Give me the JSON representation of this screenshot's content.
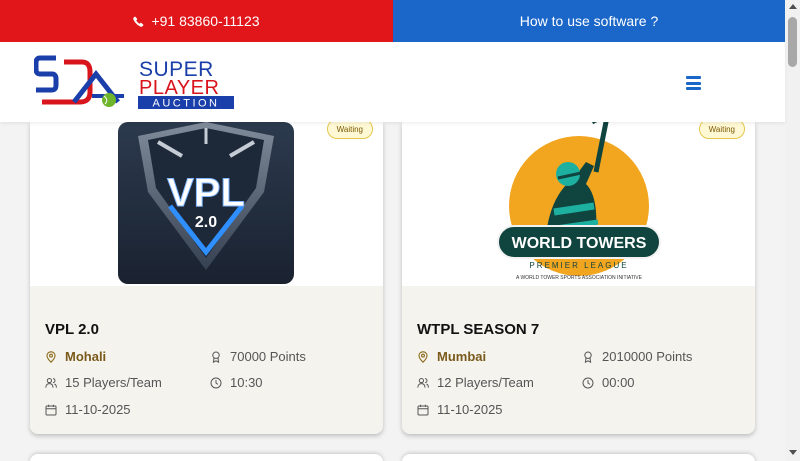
{
  "topbar": {
    "phone": "+91 83860-11123",
    "howto": "How to use software ?"
  },
  "brand": {
    "line1": "SUPER",
    "line2": "PLAYER",
    "line3": "AUCTION",
    "colors": {
      "blue": "#1a3faa",
      "red": "#d8141c",
      "green": "#6fb52c"
    }
  },
  "menu_icon": "hamburger-icon",
  "tournaments": [
    {
      "status": "Waiting",
      "logo_text": "VPL",
      "logo_sub": "2.0",
      "name": "VPL 2.0",
      "location": "Mohali",
      "points": "70000 Points",
      "players": "15 Players/Team",
      "time": "10:30",
      "date": "11-10-2025"
    },
    {
      "status": "Waiting",
      "logo_text": "WORLD TOWERS",
      "logo_sub": "PREMIER LEAGUE",
      "logo_tagline": "A WORLD TOWER SPORTS ASSOCIATION INITIATIVE",
      "name": "WTPL SEASON 7",
      "location": "Mumbai",
      "points": "2010000 Points",
      "players": "12 Players/Team",
      "time": "00:00",
      "date": "11-10-2025"
    }
  ]
}
